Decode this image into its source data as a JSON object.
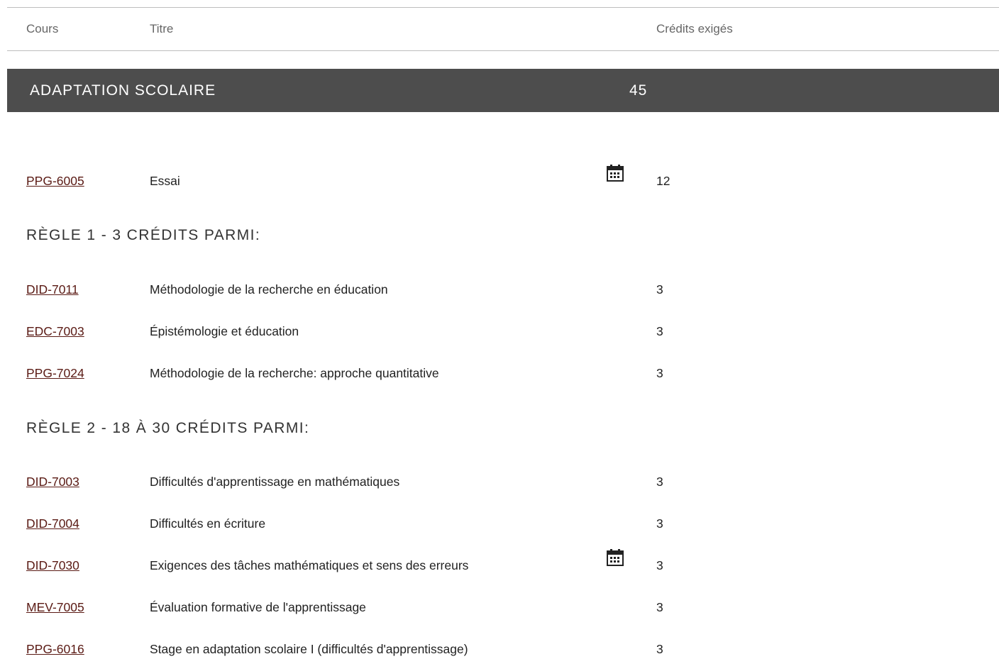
{
  "header": {
    "course": "Cours",
    "title": "Titre",
    "credits": "Crédits exigés"
  },
  "program": {
    "name": "ADAPTATION SCOLAIRE",
    "credits": "45"
  },
  "required": [
    {
      "code": "PPG-6005",
      "title": "Essai",
      "credits": "12",
      "calendar_icon": true
    }
  ],
  "rules": [
    {
      "label": "RÈGLE 1 - 3 CRÉDITS PARMI:",
      "courses": [
        {
          "code": "DID-7011",
          "title": "Méthodologie de la recherche en éducation",
          "credits": "3"
        },
        {
          "code": "EDC-7003",
          "title": "Épistémologie et éducation",
          "credits": "3"
        },
        {
          "code": "PPG-7024",
          "title": "Méthodologie de la recherche: approche quantitative",
          "credits": "3"
        }
      ]
    },
    {
      "label": "RÈGLE 2 - 18 À 30 CRÉDITS PARMI:",
      "courses": [
        {
          "code": "DID-7003",
          "title": "Difficultés d'apprentissage en mathématiques",
          "credits": "3"
        },
        {
          "code": "DID-7004",
          "title": "Difficultés en écriture",
          "credits": "3"
        },
        {
          "code": "DID-7030",
          "title": "Exigences des tâches mathématiques et sens des erreurs",
          "credits": "3",
          "calendar_icon": true
        },
        {
          "code": "MEV-7005",
          "title": "Évaluation formative de l'apprentissage",
          "credits": "3"
        },
        {
          "code": "PPG-6016",
          "title": "Stage en adaptation scolaire I (difficultés d'apprentissage)",
          "credits": "3"
        }
      ]
    }
  ],
  "icons": {
    "calendar": "calendar-icon"
  },
  "colors": {
    "bar": "#4d4d4d",
    "link": "#5a1a14"
  }
}
